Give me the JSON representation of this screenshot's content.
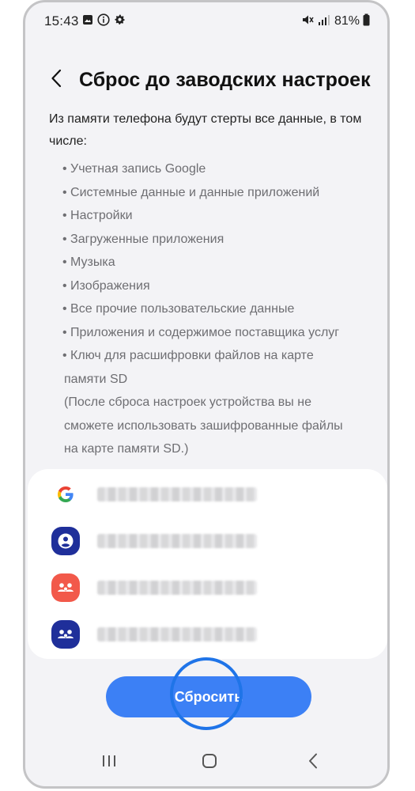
{
  "status_bar": {
    "time": "15:43",
    "battery": "81%",
    "left_icons": [
      "gallery-icon",
      "info-icon",
      "settings-gear-icon"
    ],
    "right_icons": [
      "mute-icon",
      "signal-icon",
      "battery-icon"
    ]
  },
  "header": {
    "back_icon": "chevron-left-icon",
    "title": "Сброс до заводских настроек"
  },
  "content": {
    "intro": "Из памяти телефона будут стерты все данные, в том числе:",
    "bullets": [
      "• Учетная запись Google",
      "• Системные данные и данные приложений",
      "• Настройки",
      "• Загруженные приложения",
      "• Музыка",
      "• Изображения",
      "• Все прочие пользовательские данные",
      "• Приложения и содержимое поставщика услуг",
      "• Ключ для расшифровки файлов на карте"
    ],
    "bullet_continuation": "памяти SD",
    "note_lines": [
      "(После сброса настроек устройства вы не",
      "сможете использовать зашифрованные файлы",
      "на карте памяти SD.)"
    ]
  },
  "accounts": [
    {
      "icon": "google-icon"
    },
    {
      "icon": "samsung-account-icon",
      "color": "#1f2f9a"
    },
    {
      "icon": "family-share-icon",
      "color": "#f2594a"
    },
    {
      "icon": "group-share-icon",
      "color": "#1f2f9a"
    }
  ],
  "reset_button": {
    "label": "Сбросить",
    "color": "#3c80f5"
  },
  "nav_bar": {
    "icons": [
      "recents-icon",
      "home-icon",
      "back-icon"
    ]
  }
}
